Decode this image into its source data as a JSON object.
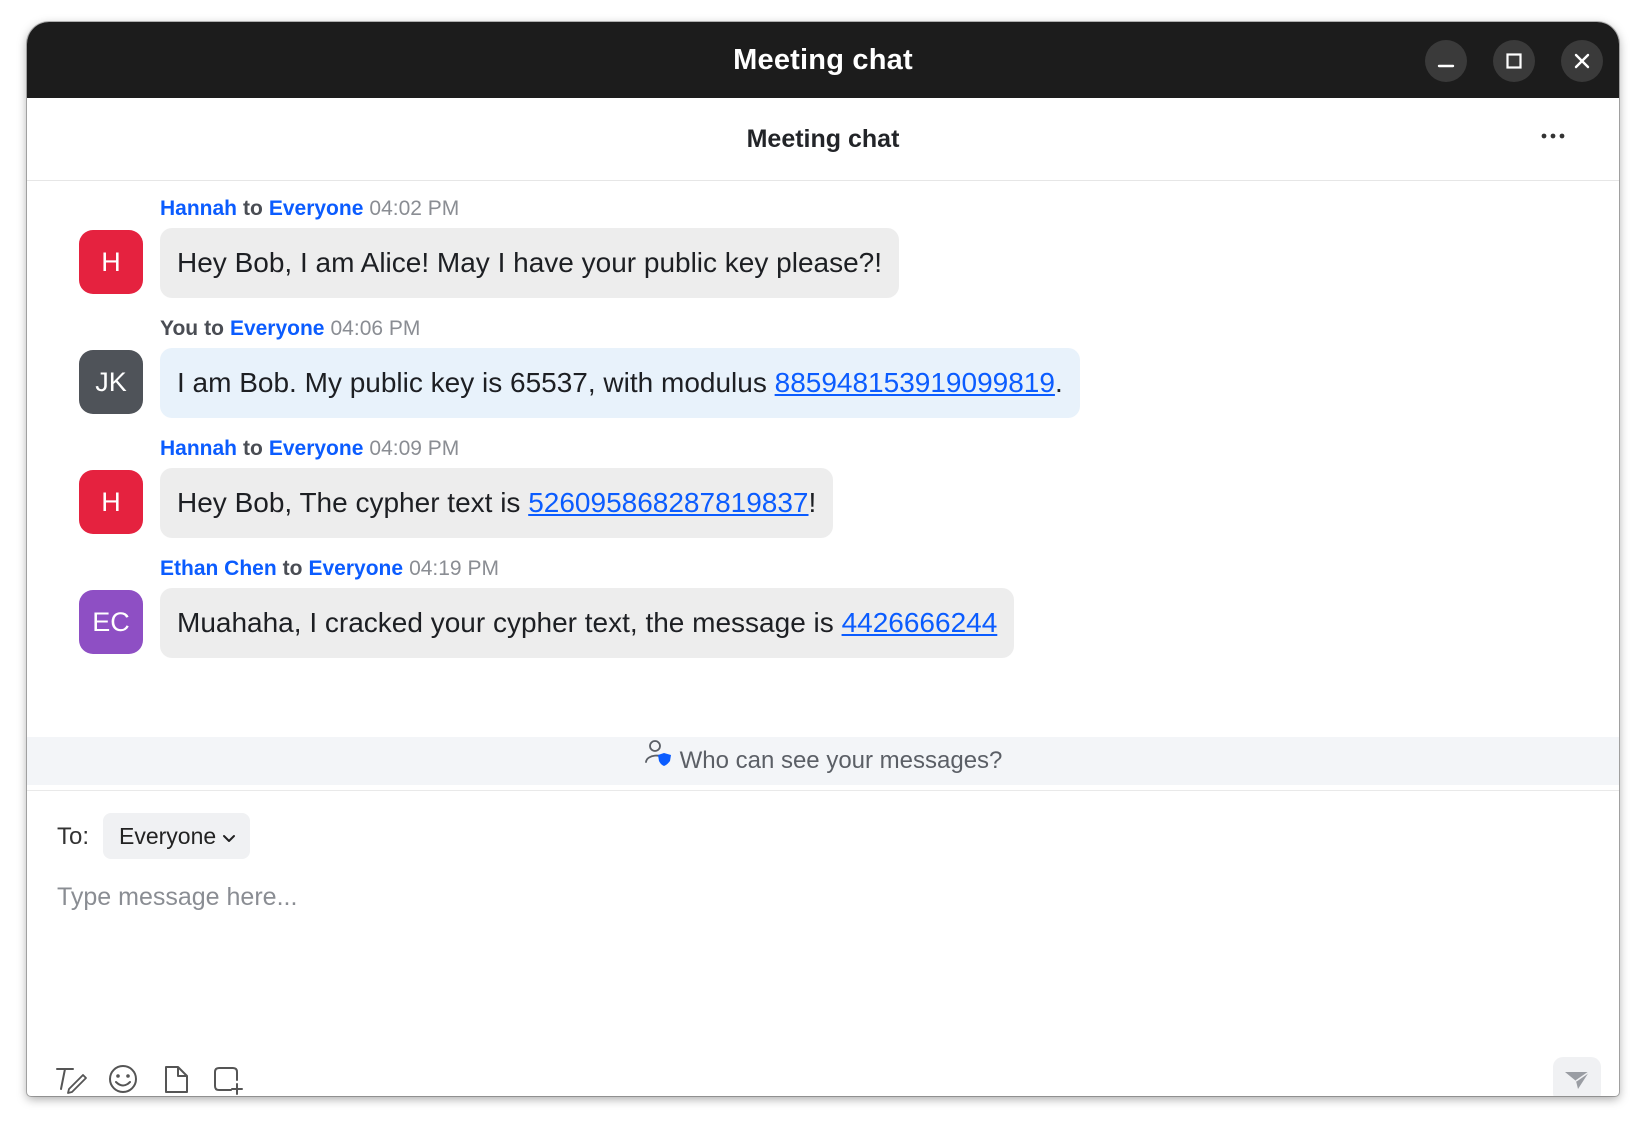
{
  "window": {
    "title": "Meeting chat",
    "controls": [
      "minimize",
      "maximize",
      "close"
    ]
  },
  "header": {
    "title": "Meeting chat",
    "more_label": "···"
  },
  "messages": [
    {
      "sender": "Hannah",
      "to_word": "to",
      "recipient": "Everyone",
      "time": "04:02 PM",
      "avatar": {
        "initials": "H",
        "color": "#e5223f"
      },
      "text_before": "Hey Bob, I am Alice! May I have your public key please?!",
      "link": "",
      "text_after": ""
    },
    {
      "sender": "You",
      "to_word": "to",
      "recipient": "Everyone",
      "time": "04:06 PM",
      "avatar": {
        "initials": "JK",
        "color": "#4f5359"
      },
      "text_before": "I am Bob. My public key is 65537, with modulus ",
      "link": "885948153919099819",
      "text_after": "."
    },
    {
      "sender": "Hannah",
      "to_word": "to",
      "recipient": "Everyone",
      "time": "04:09 PM",
      "avatar": {
        "initials": "H",
        "color": "#e5223f"
      },
      "text_before": "Hey Bob, The cypher text is ",
      "link": "526095868287819837",
      "text_after": "!"
    },
    {
      "sender": "Ethan Chen",
      "to_word": "to",
      "recipient": "Everyone",
      "time": "04:19 PM",
      "avatar": {
        "initials": "EC",
        "color": "#8e4fc4"
      },
      "text_before": "Muahaha, I cracked your cypher text, the message is ",
      "link": "4426666244",
      "text_after": ""
    }
  ],
  "privacy": {
    "text": "Who can see your messages?",
    "icon": "person-shield-icon"
  },
  "compose": {
    "to_label": "To:",
    "to_value": "Everyone",
    "placeholder": "Type message here...",
    "tools": [
      "format-text-icon",
      "emoji-icon",
      "file-icon",
      "screenshot-icon"
    ],
    "send_icon": "send-icon"
  }
}
